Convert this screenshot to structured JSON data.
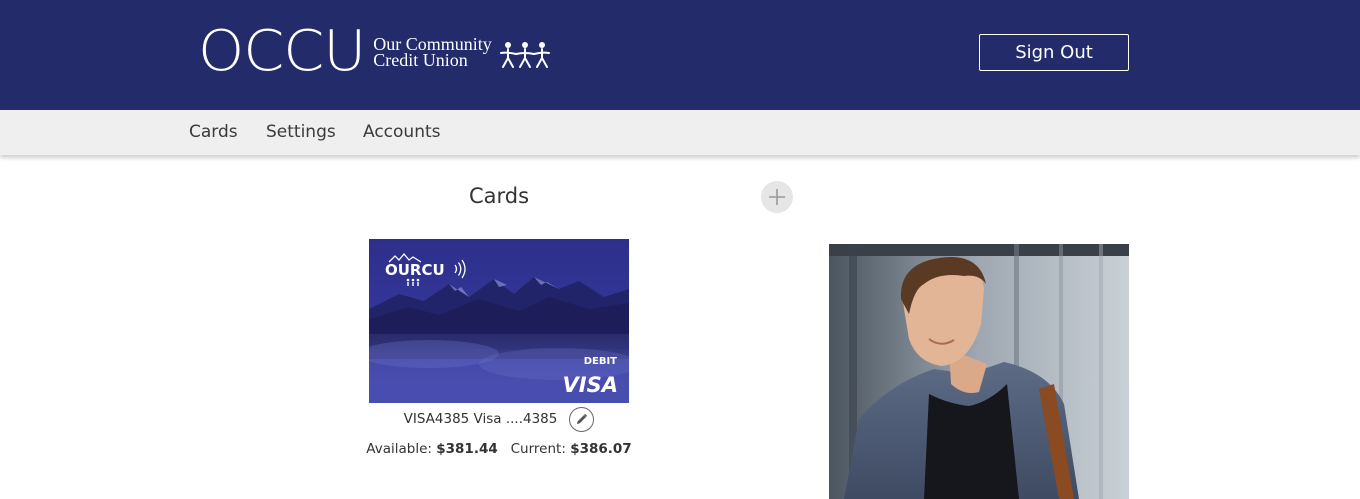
{
  "header": {
    "logo_mark": "OCCU",
    "logo_line1": "Our Community",
    "logo_line2": "Credit Union",
    "sign_out_label": "Sign Out",
    "bg_color": "#232b6b"
  },
  "nav": {
    "items": [
      {
        "label": "Cards"
      },
      {
        "label": "Settings"
      },
      {
        "label": "Accounts"
      }
    ]
  },
  "main": {
    "title": "Cards",
    "add_icon": "plus-icon",
    "card": {
      "brand_logo": "OURCU",
      "type_label": "DEBIT",
      "network_label": "VISA",
      "name": "VISA4385 Visa ....4385",
      "available_label": "Available:",
      "available_value": "$381.44",
      "current_label": "Current:",
      "current_value": "$386.07",
      "edit_icon": "pencil-icon"
    },
    "promo_image": "man-smiling-photo"
  }
}
